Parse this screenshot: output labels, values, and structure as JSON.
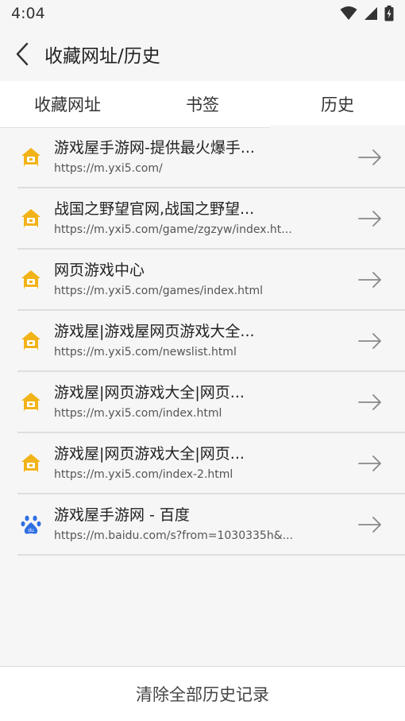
{
  "status_bar": {
    "time": "4:04"
  },
  "app_bar": {
    "title": "收藏网址/历史"
  },
  "tabs": [
    {
      "label": "收藏网址",
      "active": false
    },
    {
      "label": "书签",
      "active": false
    },
    {
      "label": "历史",
      "active": true
    }
  ],
  "history": [
    {
      "icon": "yxi5-house-icon",
      "title": "游戏屋手游网-提供最火爆手...",
      "url": "https://m.yxi5.com/"
    },
    {
      "icon": "yxi5-house-icon",
      "title": "战国之野望官网,战国之野望...",
      "url": "https://m.yxi5.com/game/zgzyw/index.ht..."
    },
    {
      "icon": "yxi5-house-icon",
      "title": "网页游戏中心",
      "url": "https://m.yxi5.com/games/index.html"
    },
    {
      "icon": "yxi5-house-icon",
      "title": "游戏屋|游戏屋网页游戏大全...",
      "url": "https://m.yxi5.com/newslist.html"
    },
    {
      "icon": "yxi5-house-icon",
      "title": "游戏屋|网页游戏大全|网页...",
      "url": "https://m.yxi5.com/index.html"
    },
    {
      "icon": "yxi5-house-icon",
      "title": "游戏屋|网页游戏大全|网页...",
      "url": "https://m.yxi5.com/index-2.html"
    },
    {
      "icon": "baidu-paw-icon",
      "title": "游戏屋手游网 - 百度",
      "url": "https://m.baidu.com/s?from=1030335h&..."
    }
  ],
  "footer": {
    "clear_label": "清除全部历史记录"
  },
  "colors": {
    "house_icon": "#f2b318",
    "baidu_icon": "#2f6fe4",
    "background": "#f6f6f6"
  }
}
